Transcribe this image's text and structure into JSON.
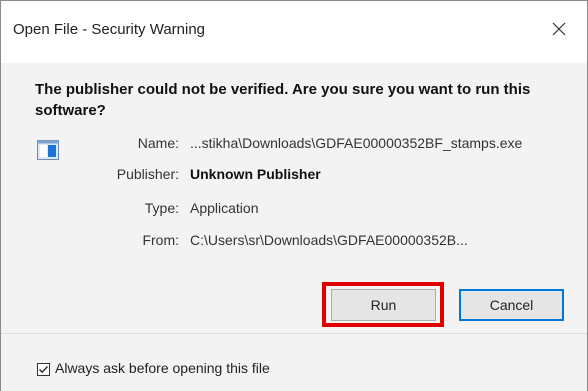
{
  "window": {
    "title": "Open File - Security Warning",
    "close_icon": "close-icon"
  },
  "warning": {
    "headline": "The publisher could not be verified.  Are you sure you want to run this software?"
  },
  "file_icon": "application-icon",
  "details": [
    {
      "label": "Name:",
      "value": "...stikha\\Downloads\\GDFAE00000352BF_stamps.exe",
      "emphasis": false
    },
    {
      "label": "Publisher:",
      "value": "Unknown Publisher",
      "emphasis": true
    },
    {
      "label": "Type:",
      "value": "Application",
      "emphasis": false
    },
    {
      "label": "From:",
      "value": "C:\\Users\\sr\\Downloads\\GDFAE00000352B...",
      "emphasis": false
    }
  ],
  "buttons": {
    "run_label": "Run",
    "cancel_label": "Cancel"
  },
  "highlight": {
    "target": "run-button",
    "color": "#e00000"
  },
  "footer": {
    "checkbox_label": "Always ask before opening this file",
    "checkbox_checked": true
  },
  "colors": {
    "accent": "#0078d7",
    "content_background": "#f3f3f3"
  }
}
